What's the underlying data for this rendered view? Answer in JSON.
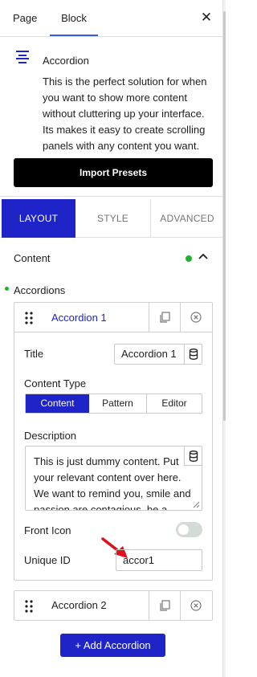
{
  "header": {
    "tabs": [
      {
        "label": "Page",
        "active": false
      },
      {
        "label": "Block",
        "active": true
      }
    ],
    "close_icon": "close-icon"
  },
  "block": {
    "icon": "accordion-icon",
    "title": "Accordion",
    "description": "This is the perfect solution for when you want to show more content without cluttering up your interface. Its makes it easy to create scrolling panels with any content you want.",
    "import_button": "Import Presets"
  },
  "settings_tabs": [
    {
      "label": "LAYOUT",
      "active": true
    },
    {
      "label": "STYLE",
      "active": false
    },
    {
      "label": "ADVANCED",
      "active": false
    }
  ],
  "content_section": {
    "title": "Content",
    "expanded": true,
    "accordions_label": "Accordions",
    "items": [
      {
        "name": "Accordion 1",
        "expanded": true,
        "title_label": "Title",
        "title_value": "Accordion 1",
        "content_type_label": "Content Type",
        "content_type_options": [
          "Content",
          "Pattern",
          "Editor"
        ],
        "content_type_selected": "Content",
        "description_label": "Description",
        "description_value": "This is just dummy content. Put your relevant content over here. We want to remind you, smile and passion are contagious, be a",
        "front_icon_label": "Front Icon",
        "front_icon_enabled": false,
        "unique_id_label": "Unique ID",
        "unique_id_value": "accor1"
      },
      {
        "name": "Accordion 2",
        "expanded": false
      }
    ],
    "add_button": "+ Add Accordion"
  },
  "colors": {
    "primary": "#1e24c8",
    "active_dot": "#1db32a",
    "annotation_arrow": "#e0101a"
  }
}
